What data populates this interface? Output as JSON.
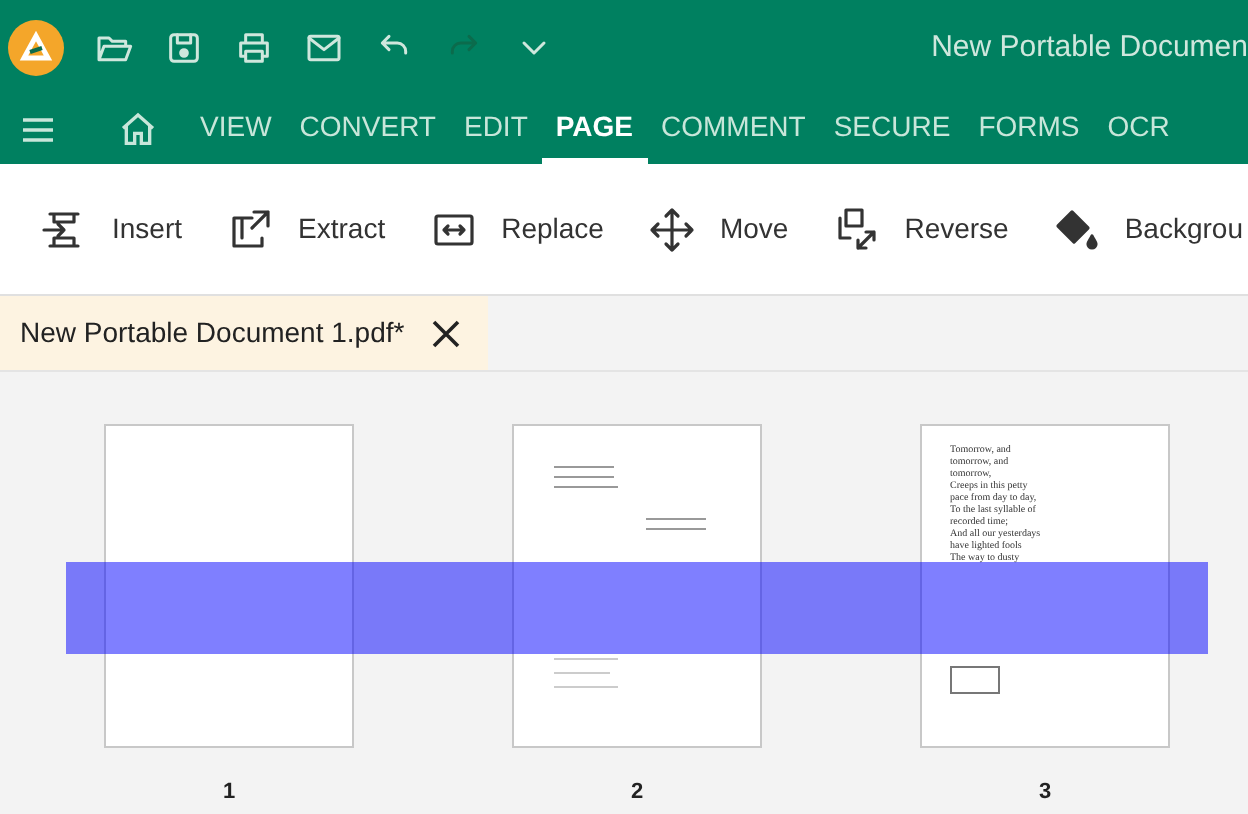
{
  "window": {
    "title": "New Portable Documen"
  },
  "quick_access": [
    {
      "kind": "open"
    },
    {
      "kind": "save"
    },
    {
      "kind": "print"
    },
    {
      "kind": "mail"
    },
    {
      "kind": "undo"
    },
    {
      "kind": "redo"
    },
    {
      "kind": "more"
    }
  ],
  "tabs": [
    {
      "label": "VIEW",
      "selected": false
    },
    {
      "label": "CONVERT",
      "selected": false
    },
    {
      "label": "EDIT",
      "selected": false
    },
    {
      "label": "PAGE",
      "selected": true
    },
    {
      "label": "COMMENT",
      "selected": false
    },
    {
      "label": "SECURE",
      "selected": false
    },
    {
      "label": "FORMS",
      "selected": false
    },
    {
      "label": "OCR",
      "selected": false
    }
  ],
  "toolbar": [
    {
      "kind": "insert",
      "label": "Insert"
    },
    {
      "kind": "extract",
      "label": "Extract"
    },
    {
      "kind": "replace",
      "label": "Replace"
    },
    {
      "kind": "move",
      "label": "Move"
    },
    {
      "kind": "reverse",
      "label": "Reverse"
    },
    {
      "kind": "background",
      "label": "Backgrou"
    }
  ],
  "document_tab": {
    "label": "New Portable Document 1.pdf*"
  },
  "pages": [
    {
      "kind": "blank",
      "number": "1"
    },
    {
      "kind": "lines",
      "number": "2"
    },
    {
      "kind": "poem",
      "number": "3",
      "lines": [
        "Tomorrow, and",
        "tomorrow, and",
        "tomorrow,",
        "Creeps in this petty",
        "pace from day to day,",
        "To the last syllable of",
        "recorded time;",
        "And all our yesterdays",
        "have lighted fools",
        "The way to dusty"
      ]
    }
  ]
}
